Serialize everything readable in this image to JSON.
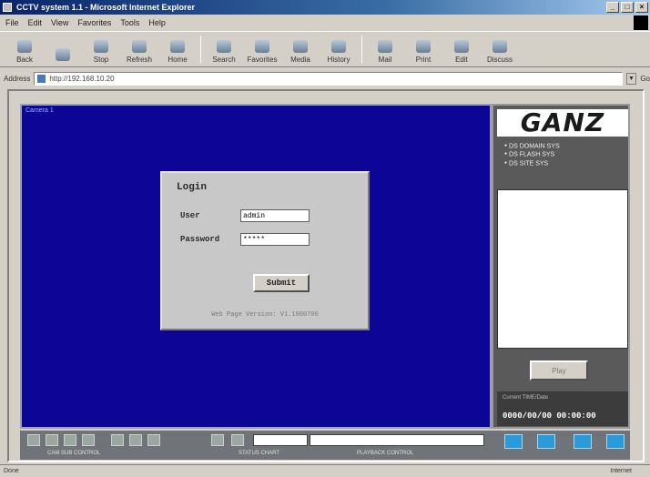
{
  "window": {
    "title": "CCTV system 1.1 - Microsoft Internet Explorer",
    "buttons": [
      "_",
      "□",
      "×"
    ]
  },
  "menu": [
    "File",
    "Edit",
    "View",
    "Favorites",
    "Tools",
    "Help"
  ],
  "toolbar": [
    {
      "label": "Back",
      "icon": "back-arrow-icon"
    },
    {
      "label": "",
      "icon": "forward-arrow-icon"
    },
    {
      "label": "Stop",
      "icon": "stop-icon"
    },
    {
      "label": "Refresh",
      "icon": "refresh-icon"
    },
    {
      "label": "Home",
      "icon": "home-icon"
    },
    {
      "label": "Search",
      "icon": "search-icon"
    },
    {
      "label": "Favorites",
      "icon": "favorites-icon"
    },
    {
      "label": "Media",
      "icon": "media-icon"
    },
    {
      "label": "History",
      "icon": "history-icon"
    },
    {
      "label": "Mail",
      "icon": "mail-icon"
    },
    {
      "label": "Print",
      "icon": "print-icon"
    },
    {
      "label": "Edit",
      "icon": "edit-icon"
    },
    {
      "label": "Discuss",
      "icon": "discuss-icon"
    }
  ],
  "address": {
    "label": "Address",
    "url": "http://192.168.10.20",
    "go": "Go"
  },
  "video": {
    "channel_label": "Camera 1"
  },
  "login": {
    "title": "Login",
    "user_label": "User",
    "user_value": "admin",
    "password_label": "Password",
    "password_value": "*****",
    "submit_label": "Submit",
    "version": "Web Page Version: V1.1000700"
  },
  "side": {
    "brand": "GANZ",
    "system_items": [
      "DS DOMAIN SYS",
      "DS FLASH SYS",
      "DS SITE SYS"
    ],
    "play_label": "Play",
    "info_caption": "Current TIME/Date",
    "datetime": "0000/00/00 00:00:00"
  },
  "bottom": {
    "caption_left": "CAM SUB CONTROL",
    "caption_mid": "STATUS CHART",
    "caption_right": "PLAYBACK CONTROL"
  },
  "status": {
    "text": "Done",
    "zone": "Internet"
  },
  "colors": {
    "video_bg": "#0c0596",
    "titlebar": "#0a246a",
    "accent_blue": "#2a9ad8"
  }
}
